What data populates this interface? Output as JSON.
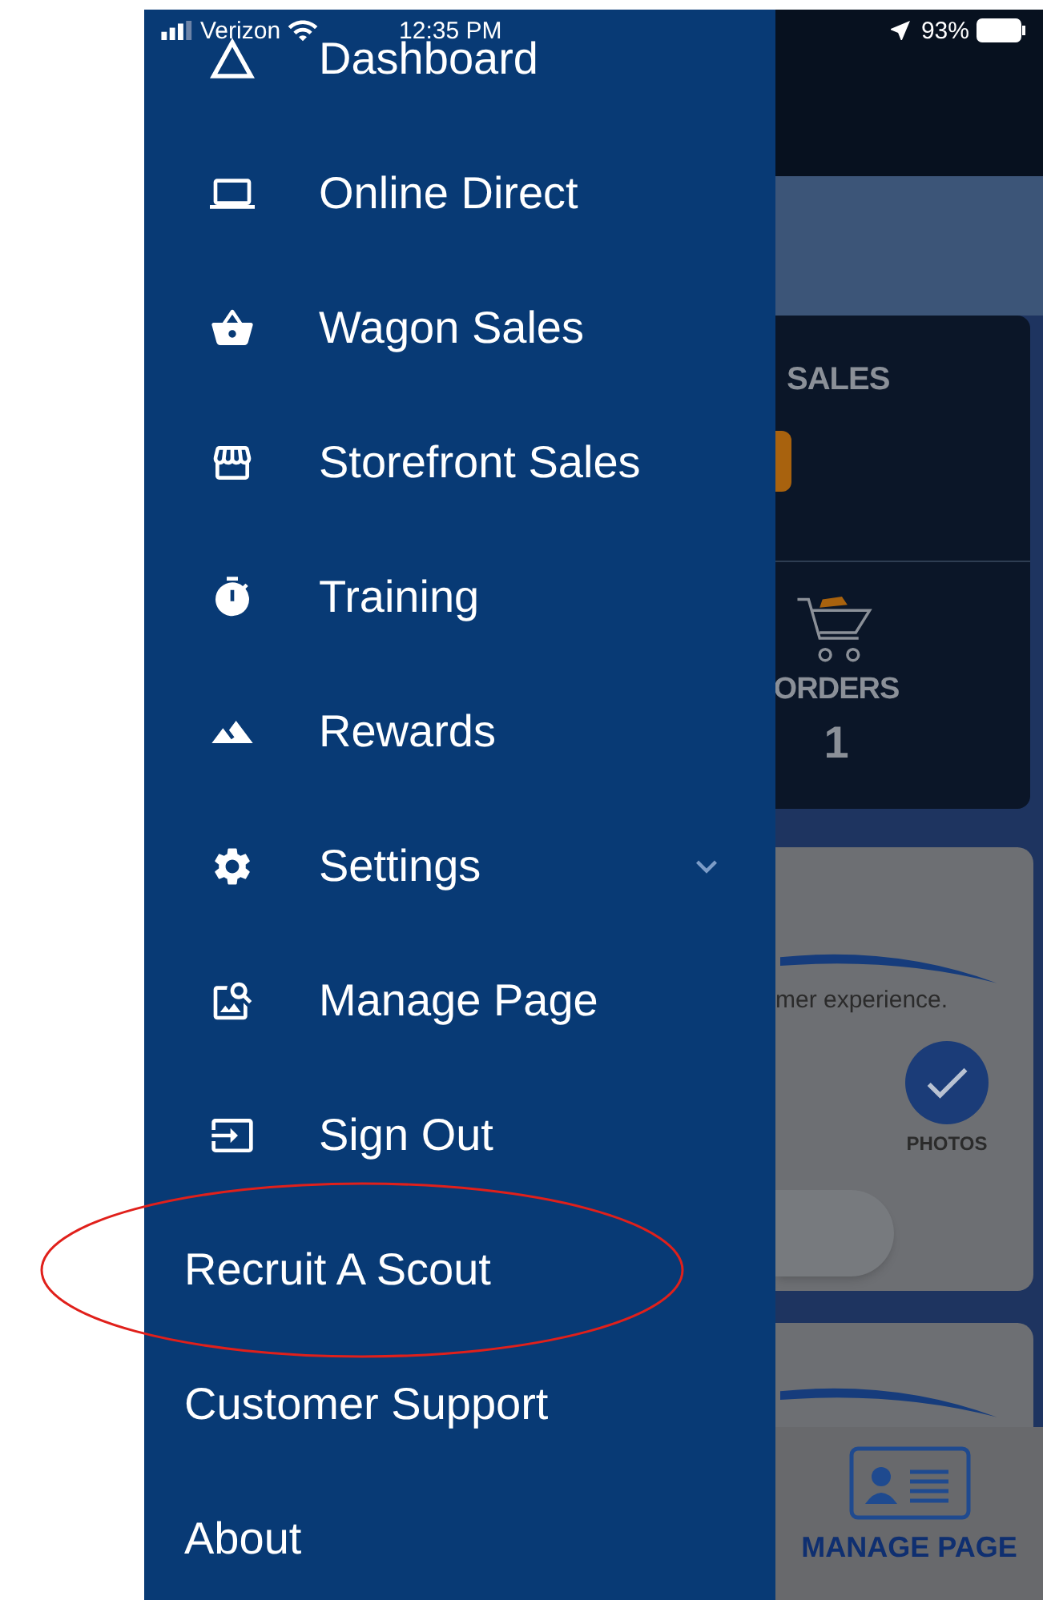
{
  "status_bar": {
    "carrier": "Verizon",
    "time": "12:35 PM",
    "battery": "93%"
  },
  "menu": {
    "items": [
      {
        "label": "Dashboard",
        "kind": "icon",
        "highlighted": false
      },
      {
        "label": "Online Direct",
        "kind": "icon",
        "highlighted": false
      },
      {
        "label": "Wagon Sales",
        "kind": "icon",
        "highlighted": false
      },
      {
        "label": "Storefront Sales",
        "kind": "icon",
        "highlighted": false
      },
      {
        "label": "Training",
        "kind": "icon",
        "highlighted": false
      },
      {
        "label": "Rewards",
        "kind": "icon",
        "highlighted": false
      },
      {
        "label": "Settings",
        "kind": "icon",
        "highlighted": false,
        "expanded": false
      },
      {
        "label": "Manage Page",
        "kind": "icon",
        "highlighted": false
      },
      {
        "label": "Sign Out",
        "kind": "icon",
        "highlighted": false
      },
      {
        "label": "Recruit A Scout",
        "kind": "plain",
        "highlighted": true
      },
      {
        "label": "Customer Support",
        "kind": "plain",
        "highlighted": false
      },
      {
        "label": "About",
        "kind": "plain",
        "highlighted": false
      }
    ]
  },
  "background": {
    "sales_heading": "SALES",
    "orders_label": "ORDERS",
    "orders_value": "1",
    "info_text": "mer experience.",
    "photos": {
      "label": "PHOTOS",
      "checked": true
    },
    "bottom_nav": "MANAGE PAGE"
  }
}
